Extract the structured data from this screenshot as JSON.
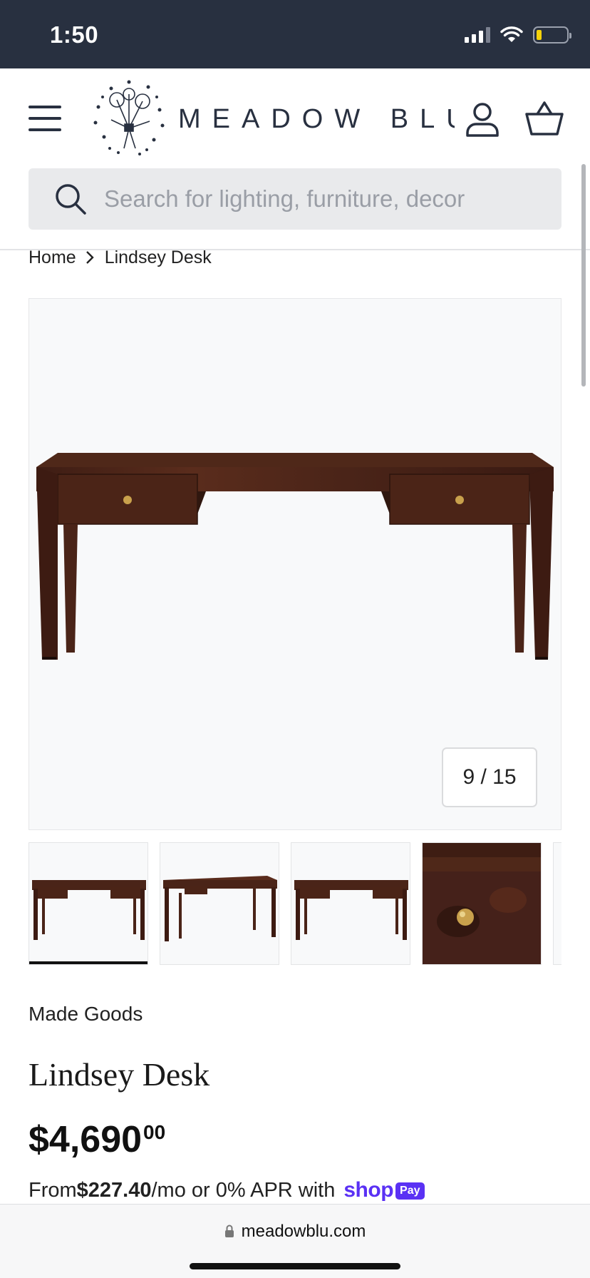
{
  "status_bar": {
    "time": "1:50"
  },
  "header": {
    "brand": "MEADOW BLU",
    "logo_icon": "dandelion-bouquet-icon",
    "menu_icon": "hamburger-menu-icon",
    "account_icon": "user-account-icon",
    "cart_icon": "shopping-basket-icon"
  },
  "search": {
    "placeholder": "Search for lighting, furniture, decor",
    "icon": "search-icon"
  },
  "breadcrumb": {
    "home": "Home",
    "current": "Lindsey Desk"
  },
  "gallery": {
    "counter": "9 / 15",
    "thumbnails": [
      "desk-front-view",
      "desk-angled-view",
      "desk-front-view-alt",
      "drawer-knob-closeup"
    ]
  },
  "product": {
    "vendor": "Made Goods",
    "title": "Lindsey Desk",
    "price_main": "$4,690",
    "price_cents": "00",
    "installment_prefix": "From ",
    "installment_amount": "$227.40",
    "installment_suffix": "/mo or 0% APR with",
    "shop_label": "shop",
    "pay_label": "Pay"
  },
  "browser": {
    "url": "meadowblu.com"
  },
  "colors": {
    "status_bar": "#283040",
    "brand": "#283040",
    "shop_pay": "#5a31f4",
    "wood": "#4a2418"
  }
}
